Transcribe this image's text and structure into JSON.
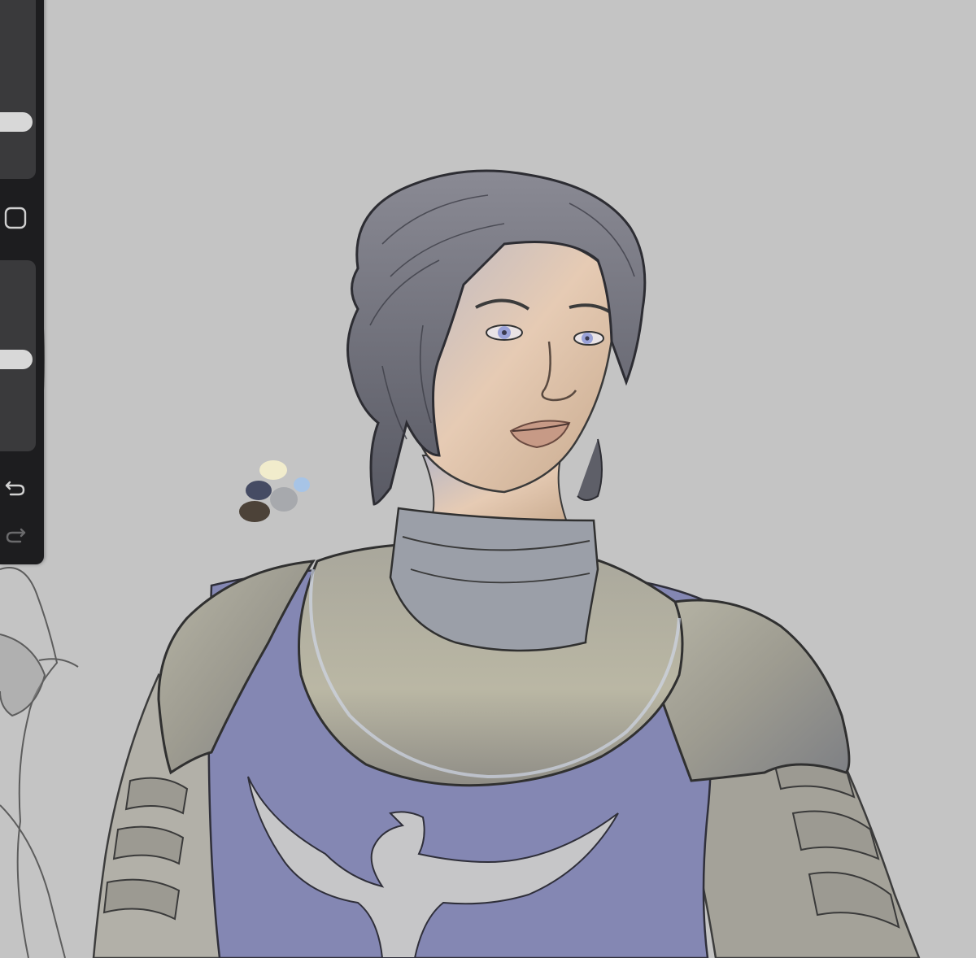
{
  "app": {
    "canvas_background": "#c4c4c4",
    "sidebar_background": "#1d1d1f"
  },
  "sidebar": {
    "brush_size": {
      "name": "brush-size-slider",
      "level": 0.27
    },
    "modify_button": {
      "icon": "square-icon"
    },
    "opacity": {
      "name": "opacity-slider",
      "level": 0.48
    },
    "undo_button": {
      "icon": "undo-icon"
    },
    "redo_button": {
      "icon": "redo-icon",
      "enabled": false
    }
  },
  "color_swatches": [
    "#f1eccc",
    "#a7c4e6",
    "#454b63",
    "#a7a9ad",
    "#4c4238"
  ],
  "artwork": {
    "tabard_color": "#8487b3",
    "armor_color": "#9c9a8e",
    "skin_color": "#e2c9b3",
    "hair_color": "#6b6c76",
    "eye_color": "#9aa2d8"
  }
}
